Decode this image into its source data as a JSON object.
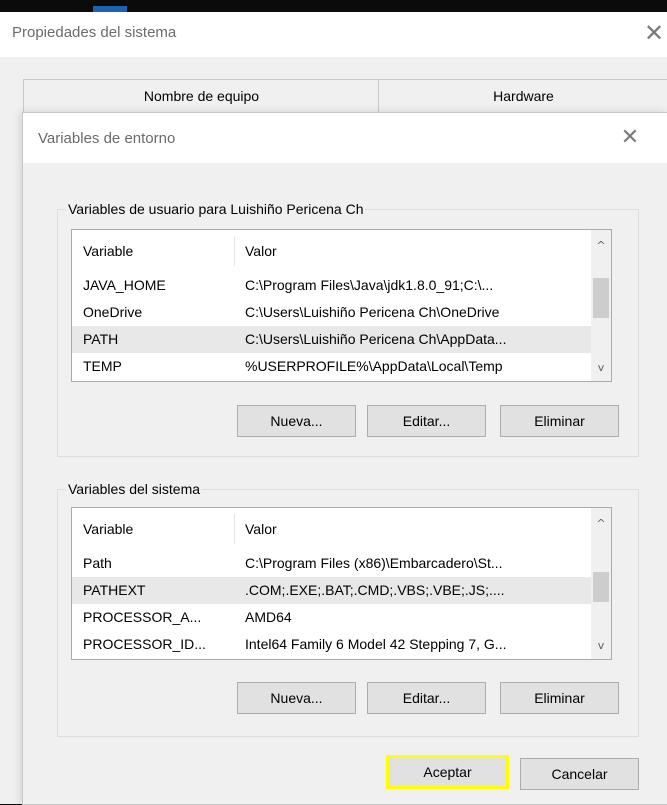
{
  "outer_window": {
    "title": "Propiedades del sistema",
    "close_glyph": "✕",
    "tabs": [
      {
        "label": "Nombre de equipo"
      },
      {
        "label": "Hardware"
      }
    ]
  },
  "dialog": {
    "title": "Variables de entorno",
    "close_glyph": "✕",
    "user_group": {
      "legend": "Variables de usuario para Luishiño Pericena Ch",
      "columns": {
        "variable": "Variable",
        "value": "Valor"
      },
      "rows": [
        {
          "variable": "JAVA_HOME",
          "value": "C:\\Program Files\\Java\\jdk1.8.0_91;C:\\..."
        },
        {
          "variable": "OneDrive",
          "value": "C:\\Users\\Luishiño Pericena Ch\\OneDrive"
        },
        {
          "variable": "PATH",
          "value": "C:\\Users\\Luishiño Pericena Ch\\AppData..."
        },
        {
          "variable": "TEMP",
          "value": "%USERPROFILE%\\AppData\\Local\\Temp"
        }
      ],
      "buttons": {
        "new": "Nueva...",
        "edit": "Editar...",
        "delete": "Eliminar"
      }
    },
    "system_group": {
      "legend": "Variables del sistema",
      "columns": {
        "variable": "Variable",
        "value": "Valor"
      },
      "rows": [
        {
          "variable": "Path",
          "value": "C:\\Program Files (x86)\\Embarcadero\\St..."
        },
        {
          "variable": "PATHEXT",
          "value": ".COM;.EXE;.BAT;.CMD;.VBS;.VBE;.JS;...."
        },
        {
          "variable": "PROCESSOR_A...",
          "value": "AMD64"
        },
        {
          "variable": "PROCESSOR_ID...",
          "value": "Intel64 Family 6 Model 42 Stepping 7, G..."
        }
      ],
      "buttons": {
        "new": "Nueva...",
        "edit": "Editar...",
        "delete": "Eliminar"
      }
    },
    "ok_label": "Aceptar",
    "cancel_label": "Cancelar"
  },
  "scroll_arrows": {
    "up": "^",
    "down": "v"
  },
  "colors": {
    "highlight_outline": "#ffff00",
    "focus_border": "#0078d7",
    "title_text": "#6b6b6b"
  },
  "icons": [
    "close-icon",
    "scroll-up-icon",
    "scroll-down-icon"
  ]
}
